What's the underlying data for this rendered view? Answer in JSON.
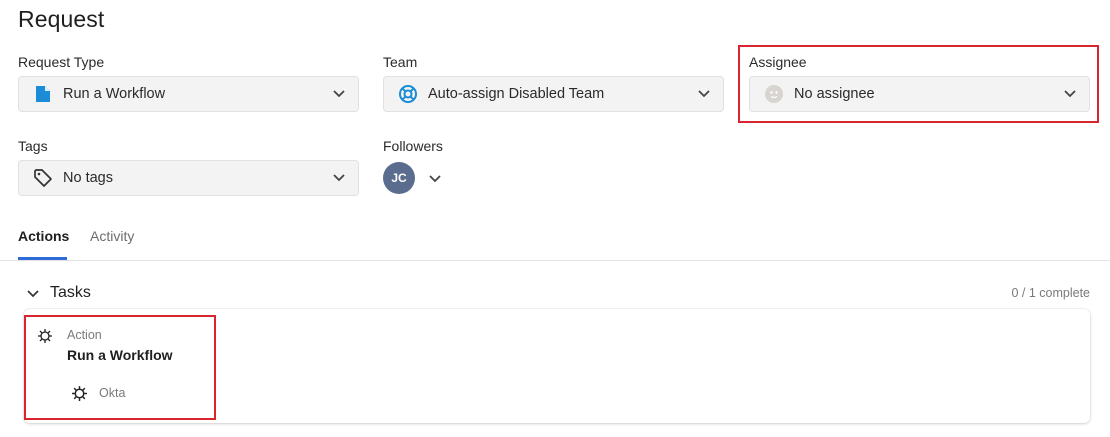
{
  "page": {
    "title": "Request"
  },
  "fields": {
    "request_type": {
      "label": "Request Type",
      "value": "Run a Workflow",
      "icon": "document-icon",
      "icon_color": "#1b8dd6"
    },
    "team": {
      "label": "Team",
      "value": "Auto-assign Disabled Team",
      "icon": "lifebuoy-icon",
      "icon_color": "#1b8dd6"
    },
    "assignee": {
      "label": "Assignee",
      "value": "No assignee",
      "icon": "empty-avatar-icon"
    },
    "tags": {
      "label": "Tags",
      "value": "No tags",
      "icon": "tag-icon"
    },
    "followers": {
      "label": "Followers",
      "avatar_initials": "JC",
      "avatar_color": "#5b6d8e"
    }
  },
  "tabs": [
    {
      "label": "Actions",
      "active": true
    },
    {
      "label": "Activity",
      "active": false
    }
  ],
  "tasks": {
    "title": "Tasks",
    "progress": "0 / 1 complete",
    "items": [
      {
        "kind": "Action",
        "name": "Run a Workflow",
        "integration": "Okta"
      }
    ]
  },
  "colors": {
    "accent": "#2e6bd6",
    "highlight": "#d9252e"
  }
}
